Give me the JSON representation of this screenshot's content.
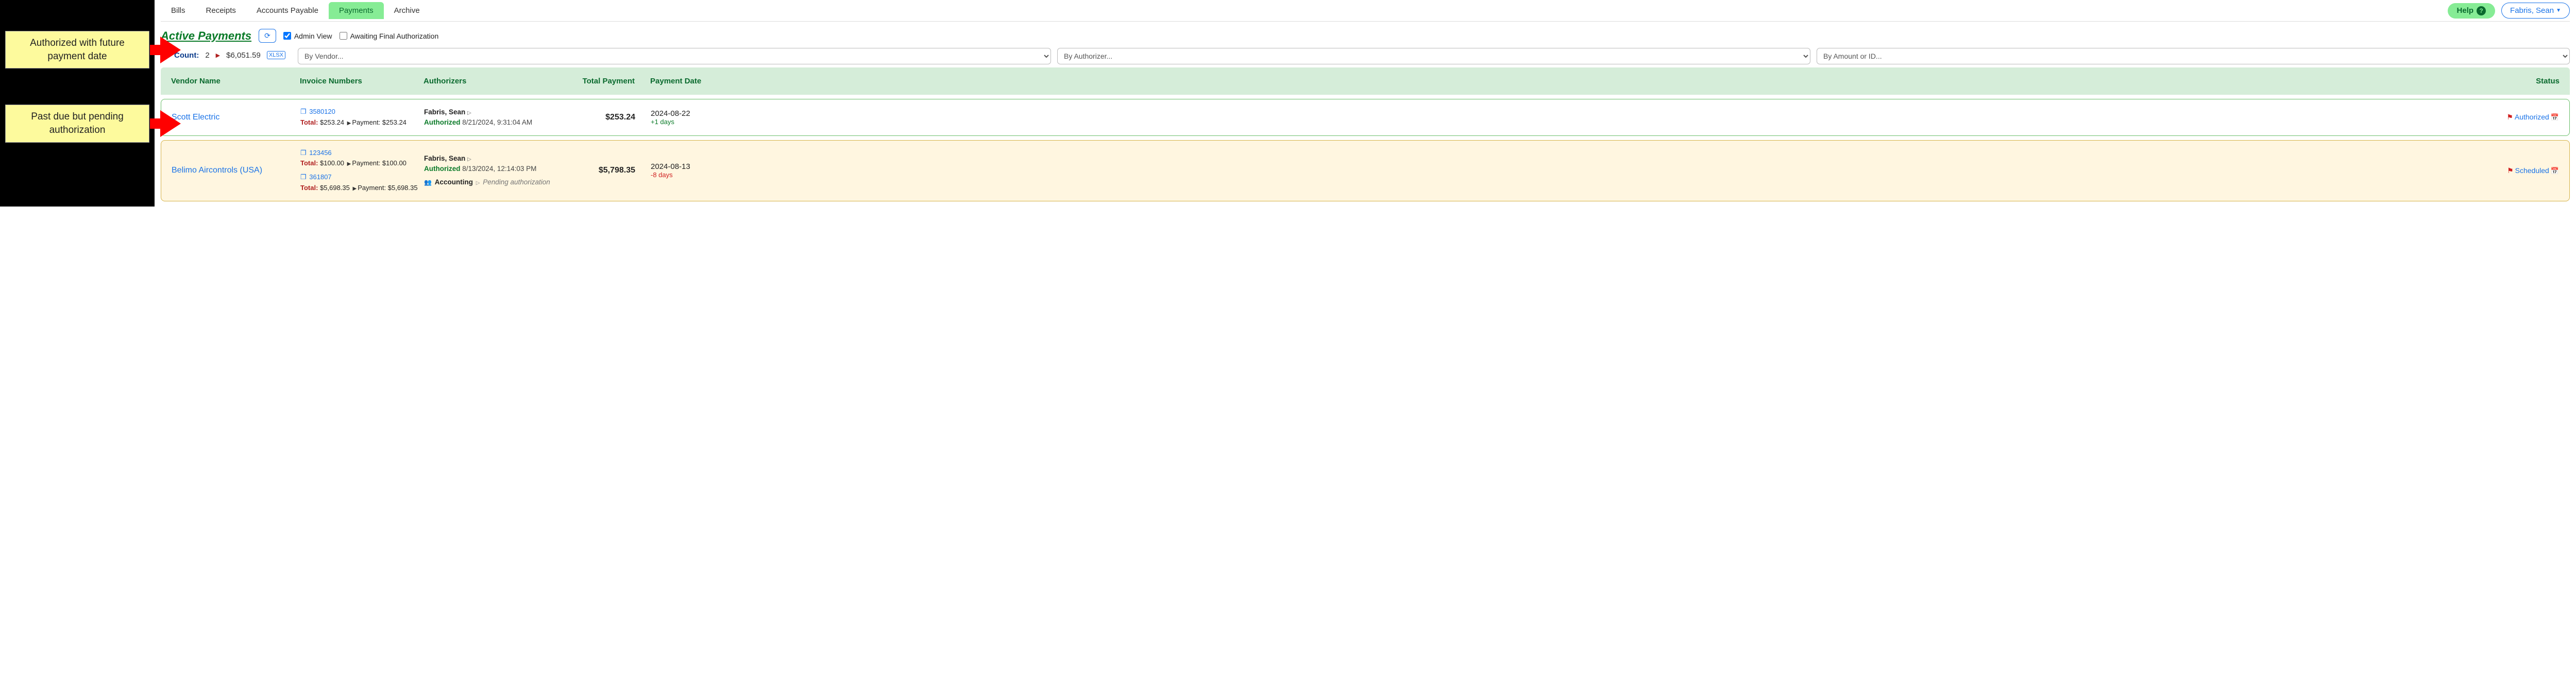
{
  "tabs": [
    "Bills",
    "Receipts",
    "Accounts Payable",
    "Payments",
    "Archive"
  ],
  "active_tab": "Payments",
  "help_label": "Help",
  "user_name": "Fabris, Sean",
  "heading": "Active Payments",
  "checks": {
    "admin_view": "Admin View",
    "awaiting": "Awaiting Final Authorization"
  },
  "counts": {
    "label": "Count:",
    "value": "2",
    "total": "$6,051.59",
    "export": "XLSX"
  },
  "filters": {
    "vendor": "By Vendor...",
    "authorizer": "By Authorizer...",
    "amount": "By Amount or ID..."
  },
  "columns": {
    "vendor": "Vendor Name",
    "inv": "Invoice Numbers",
    "auth": "Authorizers",
    "total": "Total Payment",
    "date": "Payment Date",
    "status": "Status"
  },
  "rows": [
    {
      "vendor": "Scott Electric",
      "invoices": [
        {
          "num": "3580120",
          "total_label": "Total:",
          "total": "$253.24",
          "pay_label": "Payment:",
          "pay": "$253.24"
        }
      ],
      "auth": {
        "name": "Fabris, Sean",
        "status_label": "Authorized",
        "timestamp": "8/21/2024, 9:31:04 AM"
      },
      "total": "$253.24",
      "date": "2024-08-22",
      "delta": "+1 days",
      "delta_sign": "pos",
      "status": "Authorized",
      "pending": false
    },
    {
      "vendor": "Belimo Aircontrols (USA)",
      "invoices": [
        {
          "num": "123456",
          "total_label": "Total:",
          "total": "$100.00",
          "pay_label": "Payment:",
          "pay": "$100.00"
        },
        {
          "num": "361807",
          "total_label": "Total:",
          "total": "$5,698.35",
          "pay_label": "Payment:",
          "pay": "$5,698.35"
        }
      ],
      "auth": {
        "name": "Fabris, Sean",
        "status_label": "Authorized",
        "timestamp": "8/13/2024, 12:14:03 PM",
        "pending_group": "Accounting",
        "pending_text": "Pending authorization"
      },
      "total": "$5,798.35",
      "date": "2024-08-13",
      "delta": "-8 days",
      "delta_sign": "neg",
      "status": "Scheduled",
      "pending": true
    }
  ],
  "callouts": {
    "future": "Authorized with future payment date",
    "pastdue": "Past due but pending authorization"
  }
}
